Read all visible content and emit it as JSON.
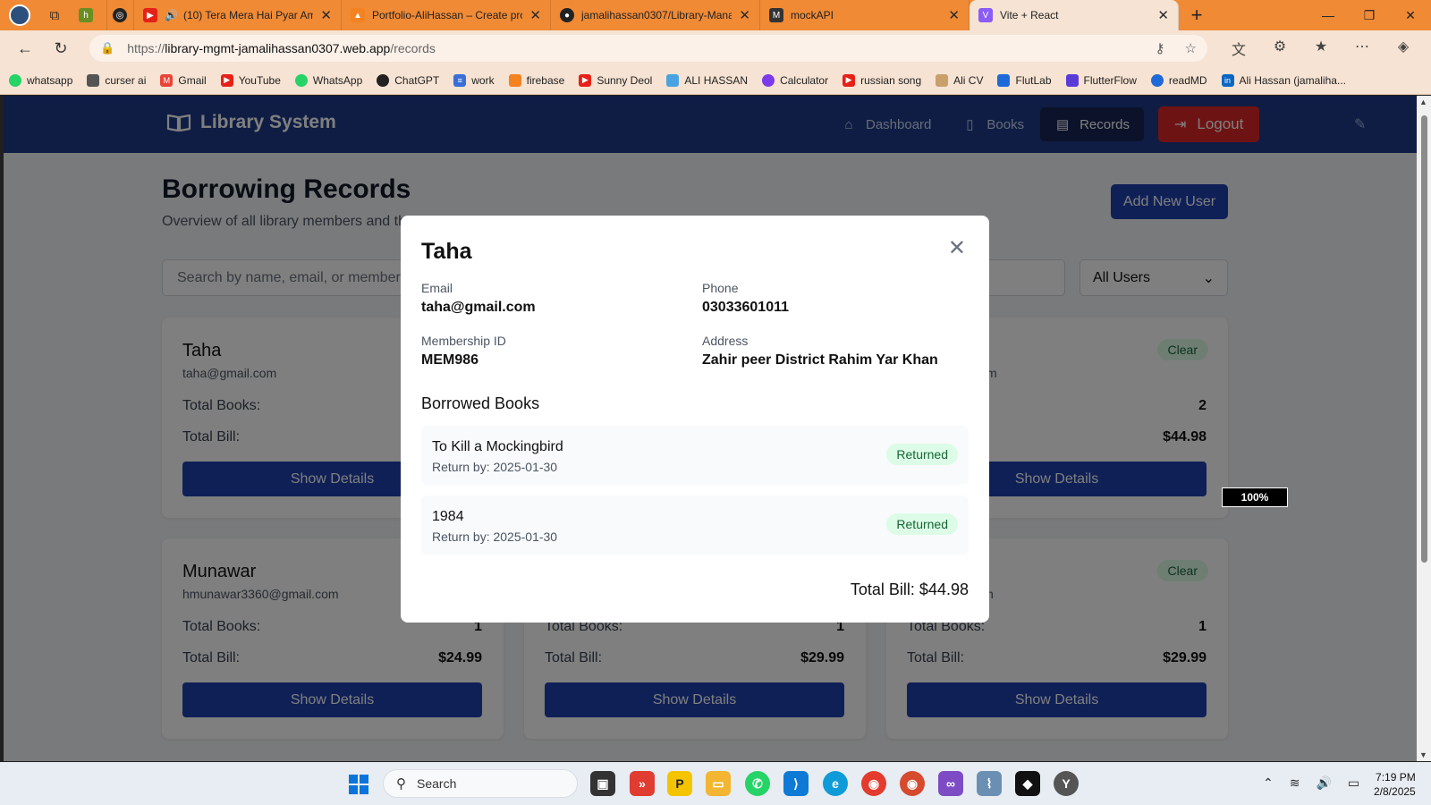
{
  "browser": {
    "tabs": [
      {
        "title": "",
        "close": ""
      },
      {
        "title": "(10) Tera Mera Hai Pyar Ama",
        "close": "✕"
      },
      {
        "title": "Portfolio-AliHassan – Create proje",
        "close": "✕"
      },
      {
        "title": "jamalihassan0307/Library-Manag",
        "close": "✕"
      },
      {
        "title": "mockAPI",
        "close": "✕"
      },
      {
        "title": "Vite + React",
        "close": "✕"
      }
    ],
    "url_prefix": "https://",
    "url_host": "library-mgmt-jamalihassan0307.web.app",
    "url_path": "/records",
    "bookmarks": [
      "whatsapp",
      "curser ai",
      "Gmail",
      "YouTube",
      "WhatsApp",
      "ChatGPT",
      "work",
      "firebase",
      "Sunny Deol",
      "ALI HASSAN",
      "Calculator",
      "russian song",
      "Ali CV",
      "FlutLab",
      "FlutterFlow",
      "readMD",
      "Ali Hassan (jamaliha..."
    ]
  },
  "app": {
    "brand": "Library System",
    "nav": {
      "dashboard": "Dashboard",
      "books": "Books",
      "records": "Records",
      "logout": "Logout"
    },
    "title": "Borrowing Records",
    "subtitle": "Overview of all library members and th",
    "add_user": "Add New User",
    "search_placeholder": "Search by name, email, or members",
    "filter_value": "All Users",
    "cards": [
      {
        "name": "Taha",
        "email": "taha@gmail.com",
        "books_label": "Total Books:",
        "books": "",
        "bill_label": "Total Bill:",
        "bill": "",
        "badge": "",
        "button": "Show Details"
      },
      {
        "name": "",
        "email": "m",
        "books_label": "",
        "books": "2",
        "bill_label": "",
        "bill": "$44.98",
        "badge": "Clear",
        "button": "Show Details"
      },
      {
        "name": "Munawar",
        "email": "hmunawar3360@gmail.com",
        "books_label": "Total Books:",
        "books": "1",
        "bill_label": "Total Bill:",
        "bill": "$24.99",
        "badge": "",
        "button": "Show Details"
      },
      {
        "name": "",
        "email": "",
        "books_label": "Total Books:",
        "books": "1",
        "bill_label": "Total Bill:",
        "bill": "$29.99",
        "badge": "",
        "button": "Show Details"
      },
      {
        "name": "",
        "email": "n",
        "books_label": "Total Books:",
        "books": "1",
        "bill_label": "Total Bill:",
        "bill": "$29.99",
        "badge": "Clear",
        "button": "Show Details"
      }
    ]
  },
  "modal": {
    "name": "Taha",
    "email_label": "Email",
    "email": "taha@gmail.com",
    "phone_label": "Phone",
    "phone": "03033601011",
    "membership_label": "Membership ID",
    "membership": "MEM986",
    "address_label": "Address",
    "address": "Zahir peer District Rahim Yar Khan",
    "borrowed_title": "Borrowed Books",
    "books": [
      {
        "title": "To Kill a Mockingbird",
        "return": "Return by: 2025-01-30",
        "status": "Returned"
      },
      {
        "title": "1984",
        "return": "Return by: 2025-01-30",
        "status": "Returned"
      }
    ],
    "total": "Total Bill: $44.98"
  },
  "zoom": "100%",
  "taskbar": {
    "search": "Search",
    "time": "7:19 PM",
    "date": "2/8/2025"
  },
  "colors": {
    "nav": "#1e3a8a",
    "primary": "#1e40af",
    "danger": "#dc2626",
    "badge_bg": "#dcfce7",
    "badge_text": "#166534",
    "tabbar": "#f08a35"
  }
}
